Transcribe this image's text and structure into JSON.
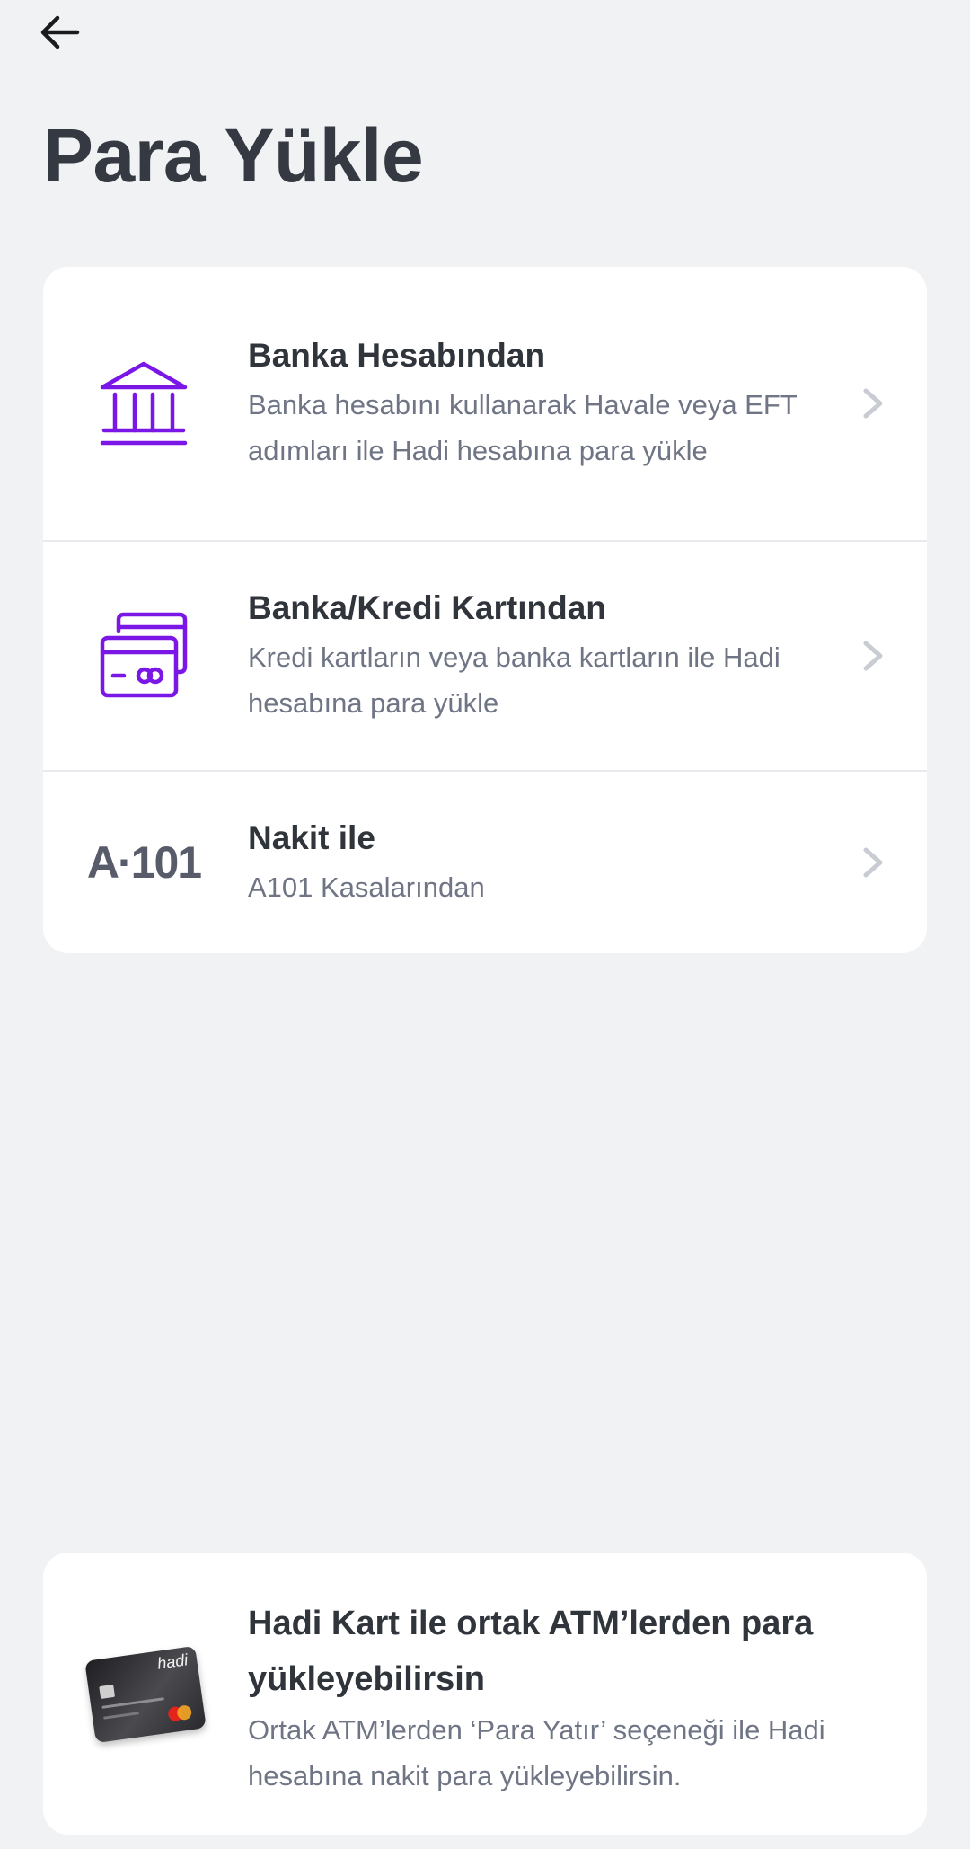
{
  "header": {
    "back_icon": "arrow-left-icon",
    "title": "Para Yükle"
  },
  "colors": {
    "accent": "#7a16e6",
    "background": "#f1f2f4",
    "title": "#353a42",
    "description": "#6f7585",
    "chevron": "#c9ccd3"
  },
  "options": [
    {
      "icon": "bank-icon",
      "title": "Banka Hesabından",
      "description": "Banka hesabını kullanarak Havale veya EFT adımları ile Hadi hesabına para yükle"
    },
    {
      "icon": "credit-cards-icon",
      "title": "Banka/Kredi Kartından",
      "description": "Kredi kartların veya banka kartların ile Hadi hesabına para yükle"
    },
    {
      "icon": "a101-logo",
      "logo_text": "A·101",
      "title": "Nakit ile",
      "description": "A101 Kasalarından"
    }
  ],
  "atm_info": {
    "card_image": "hadi-card-image",
    "card_brand_text": "hadi",
    "title": "Hadi Kart ile ortak ATM’lerden para yükleyebilirsin",
    "description": "Ortak ATM’lerden ‘Para Yatır’ seçeneği ile Hadi hesabına nakit para yükleyebilirsin."
  }
}
